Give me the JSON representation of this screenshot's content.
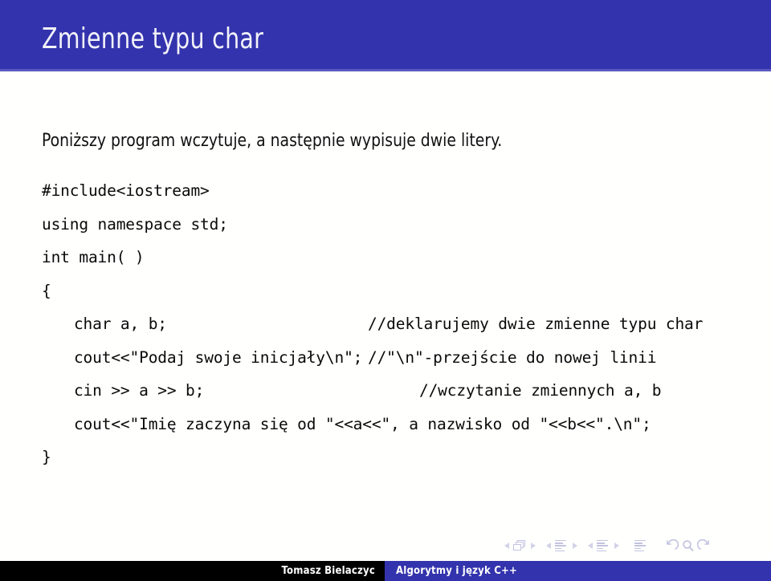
{
  "slide": {
    "title": "Zmienne typu char",
    "intro": "Poniższy program wczytuje, a następnie wypisuje dwie litery.",
    "colors": {
      "title_bar_blue": "#3333ad",
      "title_rule_blue": "#5a5ac0",
      "footer_black": "#000000",
      "footer_blue": "#3333ad",
      "nav_symbol_lavender": "#c3c3e0",
      "code_text": "#0a0a0a",
      "page_background": "#ffffff"
    }
  },
  "code": {
    "lines": [
      {
        "text": "#include<iostream>",
        "comment": "",
        "indent": false
      },
      {
        "text": "using namespace std;",
        "comment": "",
        "indent": false
      },
      {
        "text": "int main( )",
        "comment": "",
        "indent": false
      },
      {
        "text": "{",
        "comment": "",
        "indent": false
      },
      {
        "text": "char a, b;",
        "comment": "//deklarujemy dwie zmienne typu char",
        "indent": true
      },
      {
        "text": "cout<<\"Podaj swoje inicjały\\n\";",
        "comment": "//\"\\n\"-przejście do nowej linii",
        "indent": true
      },
      {
        "text": "cin >> a >> b;",
        "comment": "//wczytanie zmiennych a, b",
        "indent": true
      },
      {
        "text": "cout<<\"Imię zaczyna się od \"<<a<<\", a nazwisko od \"<<b<<\".\\n\";",
        "comment": "",
        "indent": true
      },
      {
        "text": "}",
        "comment": "",
        "indent": false
      }
    ]
  },
  "navigation": {
    "groups": [
      {
        "icon": "slides-stack-icon",
        "label_prev": "previous-slide",
        "label_next": "next-slide"
      },
      {
        "icon": "section-lines-icon",
        "label_prev": "previous-section",
        "label_next": "next-section"
      },
      {
        "icon": "subsection-lines-icon",
        "label_prev": "previous-subsection",
        "label_next": "next-subsection"
      }
    ],
    "frame_icon": "frame-lines-icon",
    "back_icon": "back-arrow-icon",
    "search_icon": "search-icon",
    "forward_icon": "forward-arrow-icon"
  },
  "footer": {
    "author": "Tomasz Bielaczyc",
    "course": "Algorytmy i język C++"
  }
}
